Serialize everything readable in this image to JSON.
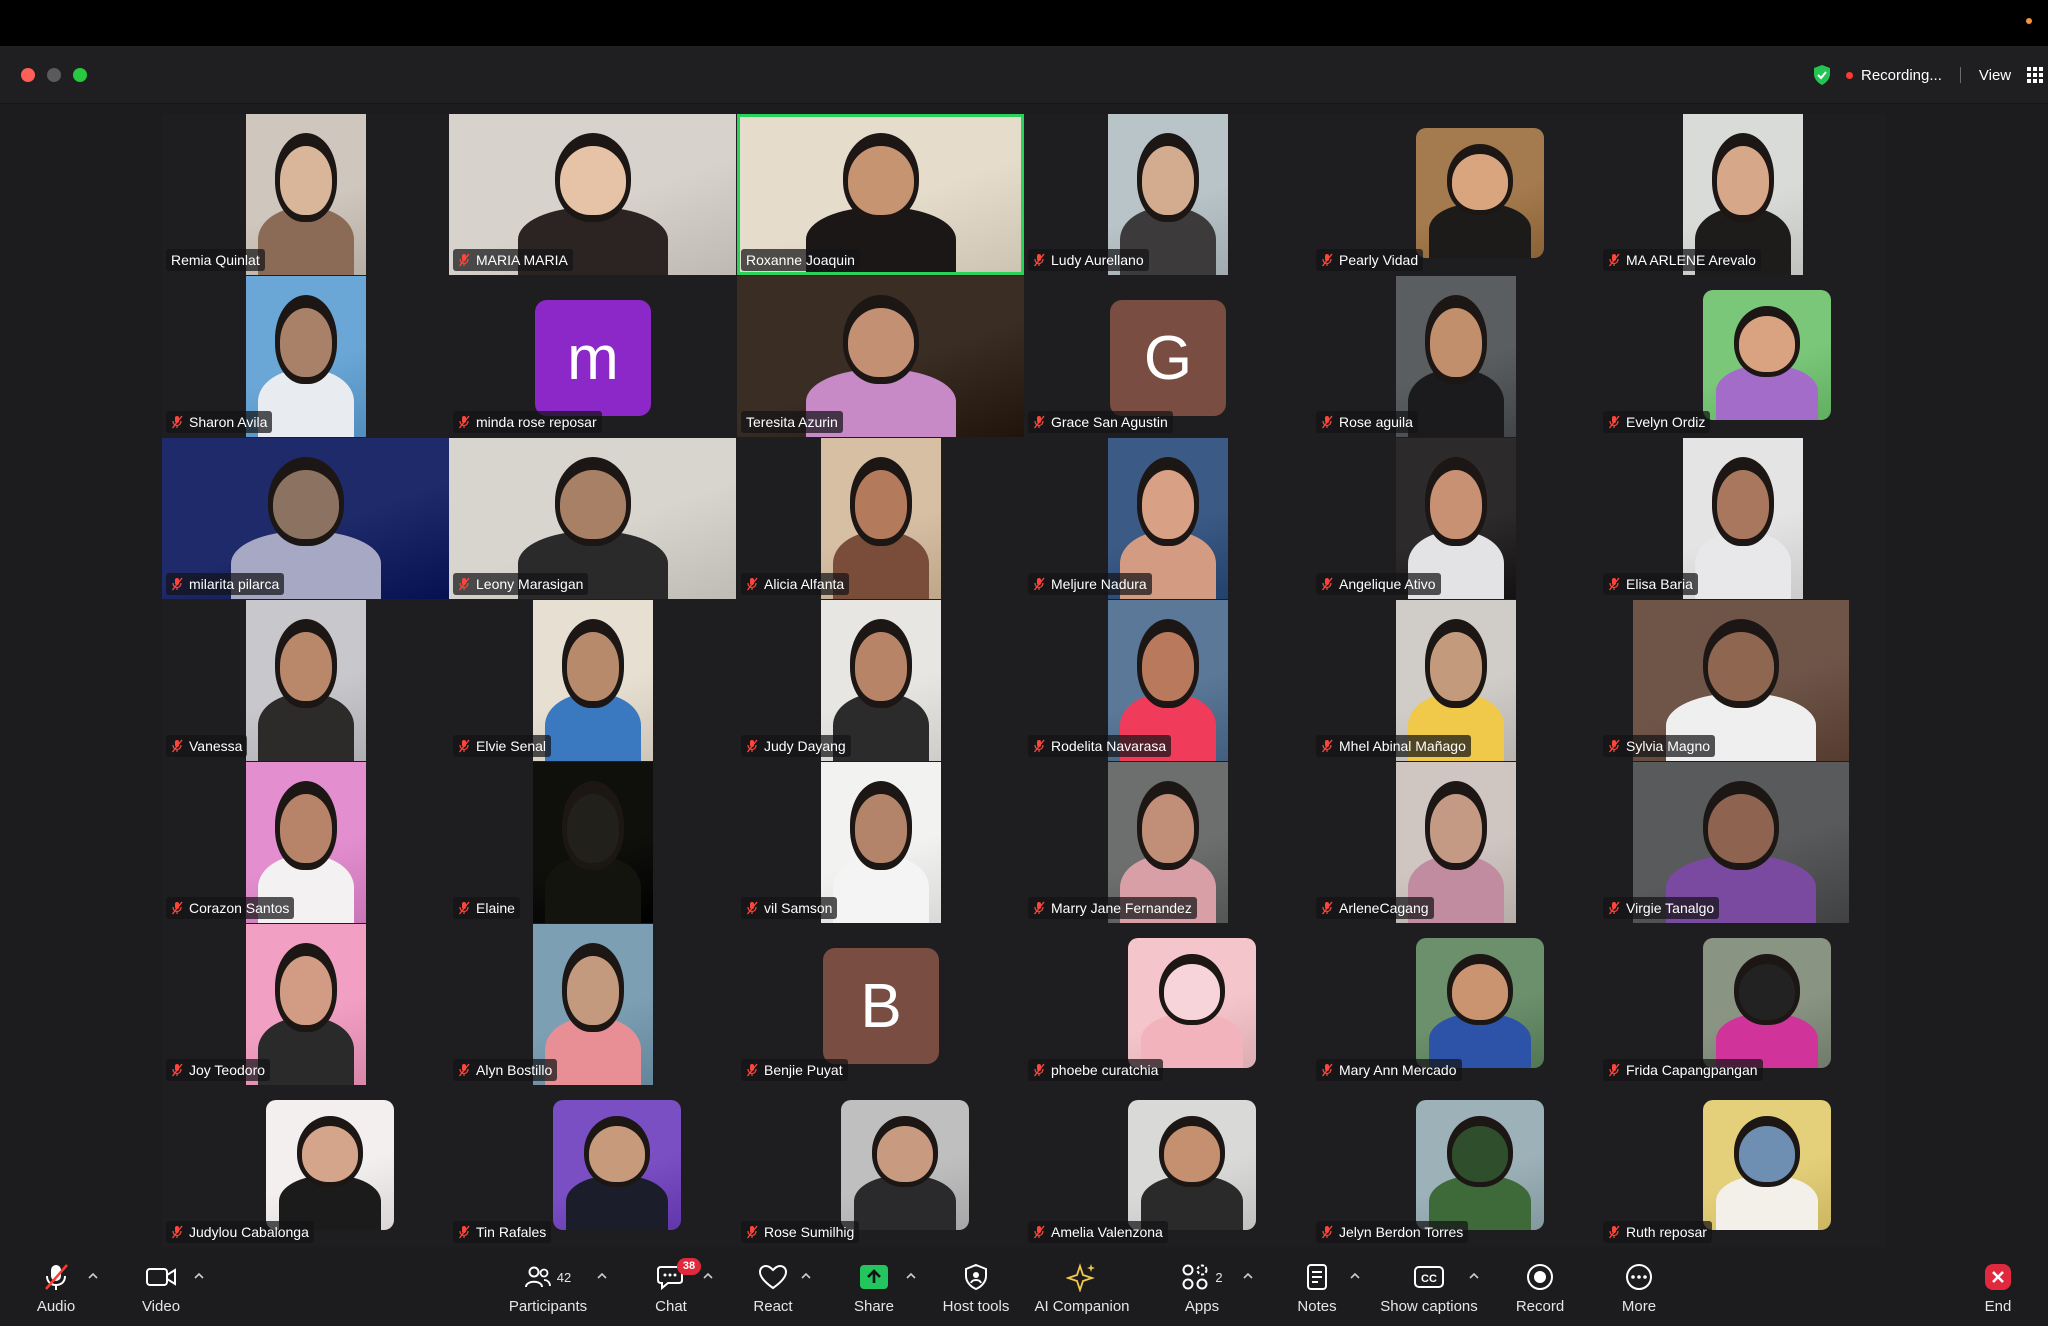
{
  "window": {
    "recording_label": "Recording...",
    "view_label": "View"
  },
  "participants": [
    {
      "name": "Remia Quinlat",
      "muted": false,
      "kind": "narrow",
      "tones": [
        "#cfc7bd",
        "#8b6a56",
        "#d9b59a"
      ]
    },
    {
      "name": "MARIA MARIA",
      "muted": true,
      "kind": "full",
      "tones": [
        "#d7d2cc",
        "#2b2422",
        "#e6c3a7"
      ]
    },
    {
      "name": "Roxanne Joaquin",
      "muted": false,
      "kind": "full",
      "active": true,
      "tones": [
        "#e5dccb",
        "#1b1716",
        "#c79472"
      ]
    },
    {
      "name": "Ludy Aurellano",
      "muted": true,
      "kind": "narrow",
      "tones": [
        "#b8c4c8",
        "#3d3a3c",
        "#d3ab8f"
      ]
    },
    {
      "name": "Pearly Vidad",
      "muted": true,
      "kind": "med",
      "tones": [
        "#a47b4e",
        "#1d1a1a",
        "#d9a57e"
      ]
    },
    {
      "name": "MA ARLENE Arevalo",
      "muted": true,
      "kind": "narrow",
      "tones": [
        "#d9dbd8",
        "#1e1b1b",
        "#d6a788"
      ]
    },
    {
      "name": "Sharon Avila",
      "muted": true,
      "kind": "narrow",
      "tones": [
        "#6aa6d6",
        "#e8ecf0",
        "#a98068"
      ]
    },
    {
      "name": "minda rose reposar",
      "muted": true,
      "kind": "avatar",
      "letter": "m",
      "color": "#8c28c8"
    },
    {
      "name": "Teresita Azurin",
      "muted": false,
      "kind": "full",
      "tones": [
        "#3a2d24",
        "#c78ac7",
        "#c39074"
      ]
    },
    {
      "name": "Grace San Agustin",
      "muted": true,
      "kind": "avatar",
      "letter": "G",
      "color": "#7a4d42"
    },
    {
      "name": "Rose aguila",
      "muted": true,
      "kind": "narrow",
      "tones": [
        "#5a5e60",
        "#1b1b1d",
        "#c18f6c"
      ]
    },
    {
      "name": "Evelyn Ordiz",
      "muted": true,
      "kind": "med",
      "tones": [
        "#7bc77a",
        "#a46cc9",
        "#d9a382"
      ]
    },
    {
      "name": "milarita pilarca",
      "muted": true,
      "kind": "full",
      "tones": [
        "#1e2a6a",
        "#a7a8c3",
        "#8c7260"
      ]
    },
    {
      "name": "Leony Marasigan",
      "muted": true,
      "kind": "full",
      "tones": [
        "#d8d4ce",
        "#2a2a2a",
        "#a78066"
      ]
    },
    {
      "name": "Alicia Alfanta",
      "muted": true,
      "kind": "narrow",
      "tones": [
        "#d7bfa3",
        "#7a4d3a",
        "#b47a5c"
      ]
    },
    {
      "name": "Meljure Nadura",
      "muted": true,
      "kind": "narrow",
      "tones": [
        "#3b5a86",
        "#d39b82",
        "#d8a085"
      ]
    },
    {
      "name": "Angelique Ativo",
      "muted": true,
      "kind": "narrow",
      "tones": [
        "#2c2a2a",
        "#e3e3e6",
        "#c89173"
      ]
    },
    {
      "name": "Elisa Baria",
      "muted": true,
      "kind": "narrow",
      "tones": [
        "#e4e4e4",
        "#e8e8ea",
        "#a8775e"
      ]
    },
    {
      "name": "Vanessa",
      "muted": true,
      "kind": "narrow",
      "tones": [
        "#c8c8cc",
        "#2d2a2a",
        "#b9876a"
      ]
    },
    {
      "name": "Elvie Senal",
      "muted": true,
      "kind": "narrow",
      "tones": [
        "#e6dfd2",
        "#3a79bf",
        "#b88a6c"
      ]
    },
    {
      "name": "Judy Dayang",
      "muted": true,
      "kind": "narrow",
      "tones": [
        "#e8e6e2",
        "#2b2b2b",
        "#b88468"
      ]
    },
    {
      "name": "Rodelita Navarasa",
      "muted": true,
      "kind": "narrow",
      "tones": [
        "#5c7898",
        "#f03c5a",
        "#b8795c"
      ]
    },
    {
      "name": "Mhel Abinal Mañago",
      "muted": true,
      "kind": "narrow",
      "tones": [
        "#d0cdc8",
        "#f0c84a",
        "#c39b7c"
      ]
    },
    {
      "name": "Sylvia Magno",
      "muted": true,
      "kind": "wide",
      "tones": [
        "#6e5548",
        "#efeff0",
        "#8f664f"
      ]
    },
    {
      "name": "Corazon Santos",
      "muted": true,
      "kind": "narrow",
      "tones": [
        "#e38fcf",
        "#f3f1f2",
        "#b7846a"
      ]
    },
    {
      "name": "Elaine",
      "muted": true,
      "kind": "narrow",
      "tones": [
        "#0f0f0c",
        "#14140f",
        "#22201a"
      ]
    },
    {
      "name": "vil Samson",
      "muted": true,
      "kind": "narrow",
      "tones": [
        "#f2f2f0",
        "#f4f4f4",
        "#b3846a"
      ]
    },
    {
      "name": "Marry Jane Fernandez",
      "muted": true,
      "kind": "narrow",
      "tones": [
        "#6d6f6e",
        "#d8a0a6",
        "#c18f77"
      ]
    },
    {
      "name": "ArleneCagang",
      "muted": true,
      "kind": "narrow",
      "tones": [
        "#cfc6c2",
        "#c28ca0",
        "#c49a85"
      ]
    },
    {
      "name": "Virgie Tanalgo",
      "muted": true,
      "kind": "wide",
      "tones": [
        "#595a5c",
        "#7a4aa0",
        "#8e6450"
      ]
    },
    {
      "name": "Joy Teodoro",
      "muted": true,
      "kind": "narrow",
      "tones": [
        "#f1a0c3",
        "#2a2a2a",
        "#d29b83"
      ]
    },
    {
      "name": "Alyn Bostillo",
      "muted": true,
      "kind": "narrow",
      "tones": [
        "#7d9fb3",
        "#e88f95",
        "#c39a7d"
      ]
    },
    {
      "name": "Benjie Puyat",
      "muted": true,
      "kind": "avatar",
      "letter": "B",
      "color": "#7a4d42"
    },
    {
      "name": "phoebe curatchia",
      "muted": true,
      "kind": "med",
      "tones": [
        "#f5c5cc",
        "#f3b3bc",
        "#f7d4d9"
      ]
    },
    {
      "name": "Mary Ann Mercado",
      "muted": true,
      "kind": "med",
      "tones": [
        "#6c8f6c",
        "#2c53a7",
        "#c9946f"
      ]
    },
    {
      "name": "Frida Capangpangan",
      "muted": true,
      "kind": "med",
      "tones": [
        "#8a9483",
        "#d0349a",
        "#222"
      ]
    },
    {
      "name": "Judylou Cabalonga",
      "muted": true,
      "kind": "med",
      "tones": [
        "#f2efee",
        "#1b1b1b",
        "#d4a58a"
      ]
    },
    {
      "name": "Tin Rafales",
      "muted": true,
      "kind": "med",
      "tones": [
        "#7a4fc4",
        "#1b1d2a",
        "#c79a7c"
      ]
    },
    {
      "name": "Rose Sumilhig",
      "muted": true,
      "kind": "med",
      "tones": [
        "#bfbfbf",
        "#2a2a2c",
        "#c89a80"
      ]
    },
    {
      "name": "Amelia Valenzona",
      "muted": true,
      "kind": "med",
      "tones": [
        "#d9dad8",
        "#2a2a2a",
        "#c4906f"
      ]
    },
    {
      "name": "Jelyn Berdon Torres",
      "muted": true,
      "kind": "med",
      "tones": [
        "#9db1b8",
        "#3e6a3a",
        "#2f4f2c"
      ]
    },
    {
      "name": "Ruth reposar",
      "muted": true,
      "kind": "med",
      "tones": [
        "#e4d07a",
        "#f3f0e9",
        "#6f8fb2"
      ]
    }
  ],
  "toolbar": {
    "audio": "Audio",
    "video": "Video",
    "participants": "Participants",
    "participants_count": "42",
    "chat": "Chat",
    "chat_badge": "38",
    "react": "React",
    "share": "Share",
    "host_tools": "Host tools",
    "ai_companion": "AI Companion",
    "apps": "Apps",
    "apps_count": "2",
    "notes": "Notes",
    "show_captions": "Show captions",
    "record": "Record",
    "more": "More",
    "end": "End"
  },
  "colors": {
    "active_speaker": "#2bd25a",
    "end_red": "#e0293d",
    "share_green": "#22c55e"
  }
}
